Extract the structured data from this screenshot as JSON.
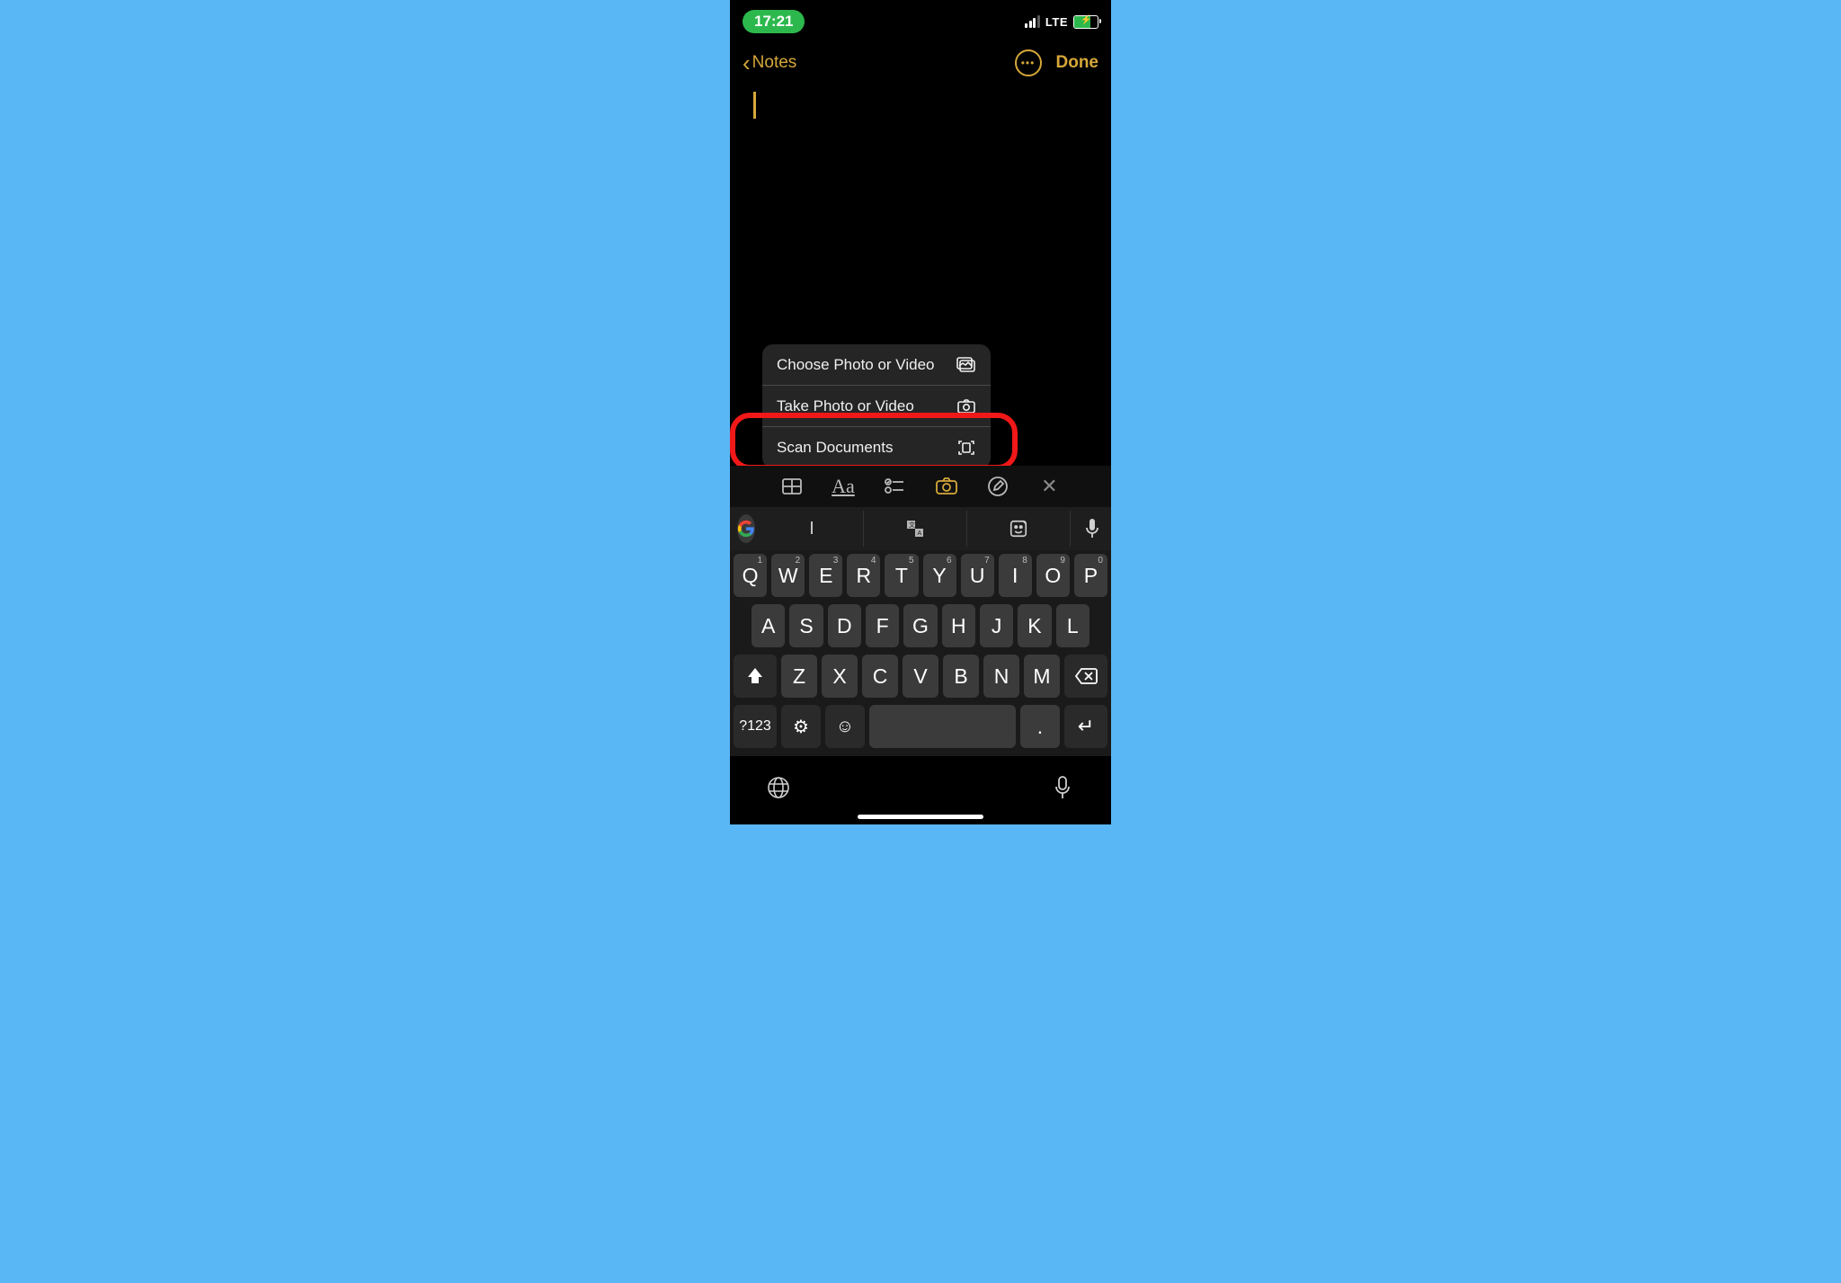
{
  "status": {
    "time": "17:21",
    "network": "LTE"
  },
  "nav": {
    "back_label": "Notes",
    "done_label": "Done"
  },
  "note": {
    "dimmed_hint": ""
  },
  "menu": {
    "items": [
      {
        "label": "Choose Photo or Video"
      },
      {
        "label": "Take Photo or Video"
      },
      {
        "label": "Scan Documents"
      }
    ]
  },
  "toolbar": {
    "aa": "Aa"
  },
  "suggestions": {
    "s0": "I"
  },
  "keyboard": {
    "row1": [
      "Q",
      "W",
      "E",
      "R",
      "T",
      "Y",
      "U",
      "I",
      "O",
      "P"
    ],
    "hints1": [
      "1",
      "2",
      "3",
      "4",
      "5",
      "6",
      "7",
      "8",
      "9",
      "0"
    ],
    "row2": [
      "A",
      "S",
      "D",
      "F",
      "G",
      "H",
      "J",
      "K",
      "L"
    ],
    "row3": [
      "Z",
      "X",
      "C",
      "V",
      "B",
      "N",
      "M"
    ],
    "numkey": "?123",
    "dot": "."
  }
}
